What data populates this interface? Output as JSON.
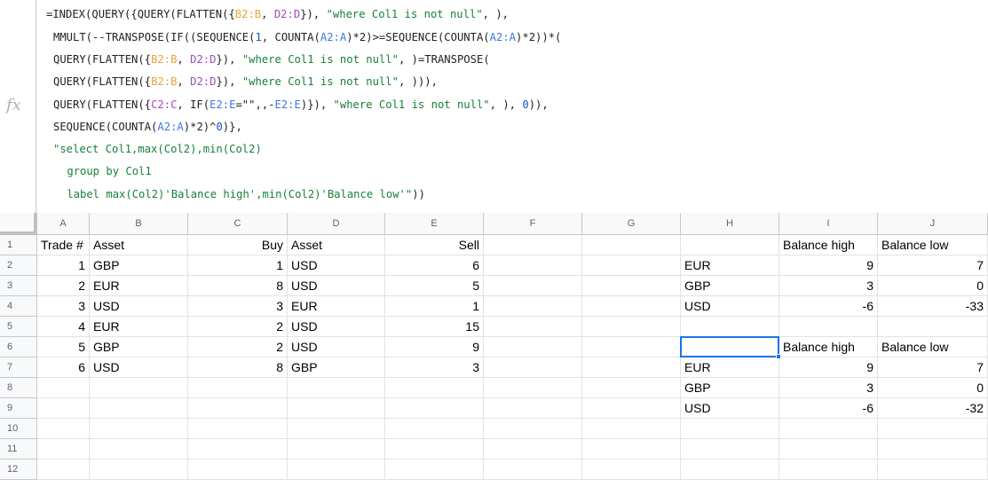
{
  "formula": {
    "fx_label": "fx",
    "lines": [
      [
        [
          "def",
          "=INDEX(QUERY({QUERY(FLATTEN({"
        ],
        [
          "r1",
          "B2:B"
        ],
        [
          "def",
          ", "
        ],
        [
          "r2",
          "D2:D"
        ],
        [
          "def",
          "}), "
        ],
        [
          "str",
          "\"where Col1 is not null\""
        ],
        [
          "def",
          ", ),"
        ]
      ],
      [
        [
          "def",
          "MMULT(--TRANSPOSE(IF((SEQUENCE("
        ],
        [
          "num",
          "1"
        ],
        [
          "def",
          ", COUNTA("
        ],
        [
          "r3",
          "A2:A"
        ],
        [
          "def",
          ")*2)>=SEQUENCE(COUNTA("
        ],
        [
          "r3",
          "A2:A"
        ],
        [
          "def",
          ")*2))*("
        ]
      ],
      [
        [
          "def",
          "QUERY(FLATTEN({"
        ],
        [
          "r1",
          "B2:B"
        ],
        [
          "def",
          ", "
        ],
        [
          "r2",
          "D2:D"
        ],
        [
          "def",
          "}), "
        ],
        [
          "str",
          "\"where Col1 is not null\""
        ],
        [
          "def",
          ", )=TRANSPOSE("
        ]
      ],
      [
        [
          "def",
          "QUERY(FLATTEN({"
        ],
        [
          "r1",
          "B2:B"
        ],
        [
          "def",
          ", "
        ],
        [
          "r2",
          "D2:D"
        ],
        [
          "def",
          "}), "
        ],
        [
          "str",
          "\"where Col1 is not null\""
        ],
        [
          "def",
          ", ))),"
        ]
      ],
      [
        [
          "def",
          "QUERY(FLATTEN({"
        ],
        [
          "r4",
          "C2:C"
        ],
        [
          "def",
          ", IF("
        ],
        [
          "r3",
          "E2:E"
        ],
        [
          "def",
          "=\"\",,-"
        ],
        [
          "r3",
          "E2:E"
        ],
        [
          "def",
          ")}), "
        ],
        [
          "str",
          "\"where Col1 is not null\""
        ],
        [
          "def",
          ", ), "
        ],
        [
          "num",
          "0"
        ],
        [
          "def",
          ")),"
        ]
      ],
      [
        [
          "def",
          "SEQUENCE(COUNTA("
        ],
        [
          "r3",
          "A2:A"
        ],
        [
          "def",
          ")*2)^"
        ],
        [
          "num",
          "0"
        ],
        [
          "def",
          ")},"
        ]
      ],
      [
        [
          "str",
          "\"select Col1,max(Col2),min(Col2)"
        ]
      ],
      [
        [
          "str",
          " group by Col1"
        ]
      ],
      [
        [
          "str",
          " label max(Col2)'Balance high',min(Col2)'Balance low'\""
        ],
        [
          "def",
          "))"
        ]
      ]
    ]
  },
  "columns": [
    "A",
    "B",
    "C",
    "D",
    "E",
    "F",
    "G",
    "H",
    "I",
    "J"
  ],
  "rows": [
    "1",
    "2",
    "3",
    "4",
    "5",
    "6",
    "7",
    "8",
    "9",
    "10",
    "11",
    "12"
  ],
  "cells": {
    "A1": "Trade #",
    "B1": "Asset",
    "C1": "Buy",
    "D1": "Asset",
    "E1": "Sell",
    "I1": "Balance high",
    "J1": "Balance low",
    "A2": "1",
    "B2": "GBP",
    "C2": "1",
    "D2": "USD",
    "E2": "6",
    "H2": "EUR",
    "I2": "9",
    "J2": "7",
    "A3": "2",
    "B3": "EUR",
    "C3": "8",
    "D3": "USD",
    "E3": "5",
    "H3": "GBP",
    "I3": "3",
    "J3": "0",
    "A4": "3",
    "B4": "USD",
    "C4": "3",
    "D4": "EUR",
    "E4": "1",
    "H4": "USD",
    "I4": "-6",
    "J4": "-33",
    "A5": "4",
    "B5": "EUR",
    "C5": "2",
    "D5": "USD",
    "E5": "15",
    "A6": "5",
    "B6": "GBP",
    "C6": "2",
    "D6": "USD",
    "E6": "9",
    "I6": "Balance high",
    "J6": "Balance low",
    "A7": "6",
    "B7": "USD",
    "C7": "8",
    "D7": "GBP",
    "E7": "3",
    "H7": "EUR",
    "I7": "9",
    "J7": "7",
    "H8": "GBP",
    "I8": "3",
    "J8": "0",
    "H9": "USD",
    "I9": "-6",
    "J9": "-32"
  },
  "selected_cell": "H6",
  "colors": {
    "selection": "#1a73e8",
    "header_bg": "#f8f9fa",
    "string_token": "#188038",
    "range_b": "#e8a33c",
    "range_d": "#9c4cc2",
    "range_a": "#3b78e7",
    "number_token": "#1155cc"
  }
}
